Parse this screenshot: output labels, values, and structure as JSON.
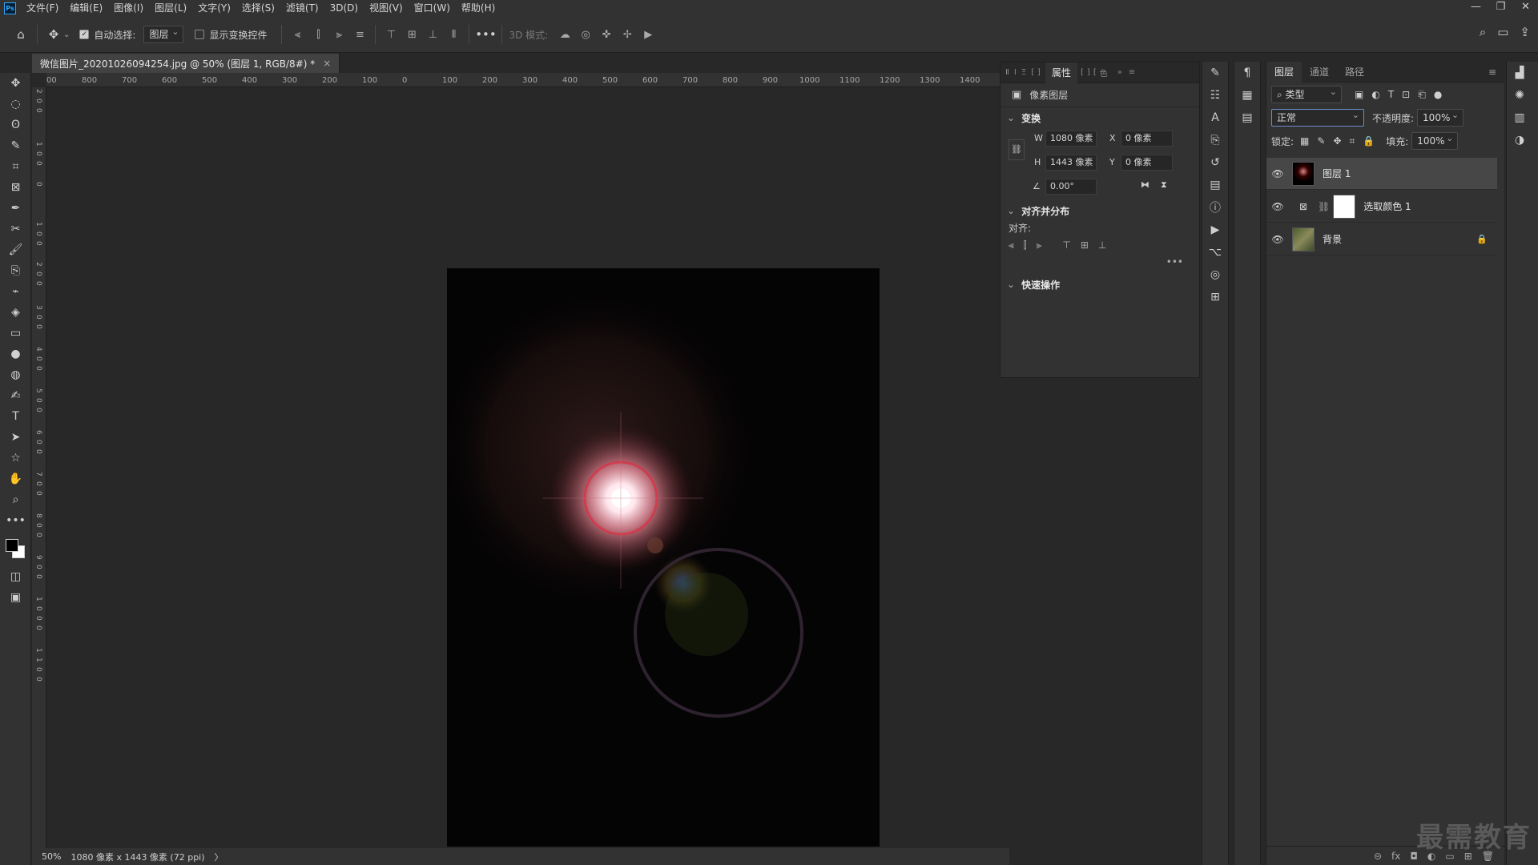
{
  "menubar": {
    "logo": "Ps",
    "items": [
      "文件(F)",
      "编辑(E)",
      "图像(I)",
      "图层(L)",
      "文字(Y)",
      "选择(S)",
      "滤镜(T)",
      "3D(D)",
      "视图(V)",
      "窗口(W)",
      "帮助(H)"
    ],
    "win_min": "—",
    "win_restore": "❐",
    "win_close": "✕"
  },
  "options": {
    "home": "⌂",
    "move": "✥",
    "auto_select_label": "自动选择:",
    "auto_select_value": "图层",
    "show_transform": "显示变换控件",
    "more": "•••",
    "mode3d": "3D 模式:"
  },
  "tools": [
    "✥",
    "◌",
    "ʘ",
    "✎",
    "⌗",
    "⊠",
    "✒",
    "✂",
    "🖌",
    "⎘",
    "⌁",
    "◈",
    "▭",
    "●",
    "◍",
    "✍",
    "T",
    "➤",
    "☆",
    "✋",
    "⌕",
    "•••"
  ],
  "doc": {
    "tab_title": "微信图片_20201026094254.jpg @ 50% (图层 1, RGB/8#) *",
    "close": "×"
  },
  "ruler_h": [
    "00",
    "800",
    "700",
    "600",
    "500",
    "400",
    "300",
    "200",
    "100",
    "0",
    "100",
    "200",
    "300",
    "400",
    "500",
    "600",
    "700",
    "800",
    "900",
    "1000",
    "1100",
    "1200",
    "1300",
    "1400"
  ],
  "ruler_v": [
    "2",
    "0",
    "0",
    "1",
    "0",
    "0",
    "0",
    "1",
    "0",
    "0",
    "2",
    "0",
    "0",
    "3",
    "0",
    "0",
    "4",
    "0",
    "0",
    "5",
    "0",
    "0",
    "6",
    "0",
    "0",
    "7",
    "0",
    "0",
    "8",
    "0",
    "0",
    "9",
    "0",
    "0",
    "1",
    "0",
    "0",
    "0",
    "1",
    "1",
    "0",
    "0"
  ],
  "status": {
    "zoom": "50%",
    "size": "1080 像素 x 1443 像素 (72 ppi)",
    "arrow": "〉"
  },
  "properties": {
    "tab": "属性",
    "tab_chars": [
      "Ⅱ",
      "Ⅰ",
      "Ξ",
      "⁅",
      "⁆",
      "⁅",
      "⁆",
      "⁅",
      "色"
    ],
    "type": "像素图层",
    "transform": "变换",
    "w_label": "W",
    "w": "1080 像素",
    "x_label": "X",
    "x": "0 像素",
    "h_label": "H",
    "h": "1443 像素",
    "y_label": "Y",
    "y": "0 像素",
    "angle": "0.00°",
    "align": "对齐并分布",
    "align_sub": "对齐:",
    "more": "•••",
    "quick": "快速操作"
  },
  "layers": {
    "tabs": [
      "图层",
      "通道",
      "路径"
    ],
    "filter": "类型",
    "blend": "正常",
    "opacity_label": "不透明度:",
    "opacity": "100%",
    "lock_label": "锁定:",
    "fill_label": "填充:",
    "fill": "100%",
    "rows": [
      {
        "name": "图层 1"
      },
      {
        "name": "选取颜色 1"
      },
      {
        "name": "背景"
      }
    ],
    "footer": [
      "⊝",
      "fx",
      "◘",
      "◐",
      "▭",
      "⊞",
      "🗑"
    ]
  },
  "watermark": "最需教育"
}
